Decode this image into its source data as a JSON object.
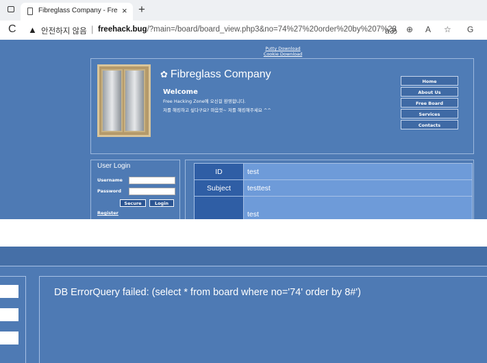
{
  "browser": {
    "tab_title": "Fibreglass Company - Free Webs",
    "tab_close": "×",
    "new_tab": "+",
    "reload": "C",
    "warning_icon": "▲",
    "insecure_label": "안전하지 않음",
    "separator": "|",
    "url_domain": "freehack.bug",
    "url_path": "/?main=/board/board_view.php3&no=74%27%20order%20by%207%23",
    "toolbar_icons": [
      "aあ",
      "⊕",
      "A",
      "☆",
      "G"
    ]
  },
  "site": {
    "top_links": [
      "Putty Download",
      "Cookie Download"
    ],
    "brand": "Fibreglass Company",
    "welcome_title": "Welcome",
    "welcome_line1": "Free Hacking Zone에 오신걸 환영합니다.",
    "welcome_line2": "저를 해킹하고 싶다구요? 마음껏~ 저를 해킹해주세요 ^^",
    "menu": [
      "Home",
      "About Us",
      "Free Board",
      "Services",
      "Contacts"
    ],
    "login": {
      "title": "User Login",
      "username_label": "Username",
      "password_label": "Password",
      "secure_label": "Secure",
      "login_label": "Login",
      "register_label": "Register"
    },
    "board": {
      "id_label": "ID",
      "id_value": "test",
      "subject_label": "Subject",
      "subject_value": "testtest",
      "content_value": "test"
    }
  },
  "zoom": {
    "error_text": "DB ErrorQuery failed: (select * from board where no='74' order by 8#')"
  }
}
